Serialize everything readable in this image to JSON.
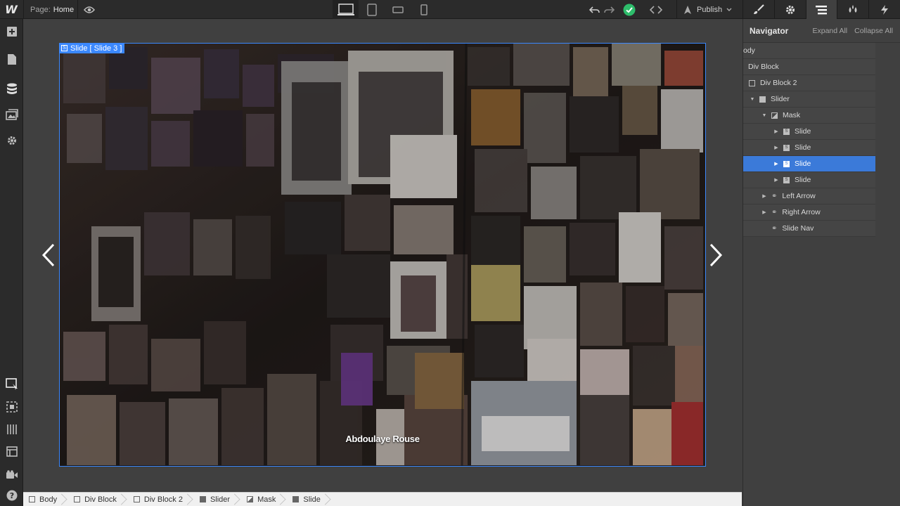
{
  "topbar": {
    "logo": "W",
    "page_label": "Page:",
    "page_value": "Home",
    "publish_label": "Publish"
  },
  "canvas": {
    "slide_label": "Slide [ Slide 3 ]",
    "slide_caption": "Abdoulaye Rouse"
  },
  "navigator": {
    "title": "Navigator",
    "expand_all": "Expand All",
    "collapse_all": "Collapse All",
    "nodes": [
      {
        "label": "ody",
        "icon": "body-icon"
      },
      {
        "label": "Div Block",
        "icon": "div-icon"
      },
      {
        "label": "Div Block 2",
        "icon": "div-icon"
      },
      {
        "label": "Slider",
        "icon": "slider-icon"
      },
      {
        "label": "Mask",
        "icon": "mask-icon"
      },
      {
        "label": "Slide",
        "icon": "slide-icon"
      },
      {
        "label": "Slide",
        "icon": "slide-icon"
      },
      {
        "label": "Slide",
        "icon": "slide-icon",
        "selected": true
      },
      {
        "label": "Slide",
        "icon": "slide-icon"
      },
      {
        "label": "Left Arrow",
        "icon": "link-icon"
      },
      {
        "label": "Right Arrow",
        "icon": "link-icon"
      },
      {
        "label": "Slide Nav",
        "icon": "link-icon"
      }
    ]
  },
  "breadcrumbs": [
    {
      "label": "Body",
      "icon": "body-icon"
    },
    {
      "label": "Div Block",
      "icon": "div-icon"
    },
    {
      "label": "Div Block 2",
      "icon": "div-icon"
    },
    {
      "label": "Slider",
      "icon": "slider-icon"
    },
    {
      "label": "Mask",
      "icon": "mask-icon"
    },
    {
      "label": "Slide",
      "icon": "slide-icon"
    }
  ],
  "colors": {
    "accent": "#3b88fd",
    "selected_row": "#3b7ad9",
    "publish_ok": "#2ebd6b",
    "panel_bg": "#404040",
    "topbar_bg": "#2b2b2b"
  }
}
